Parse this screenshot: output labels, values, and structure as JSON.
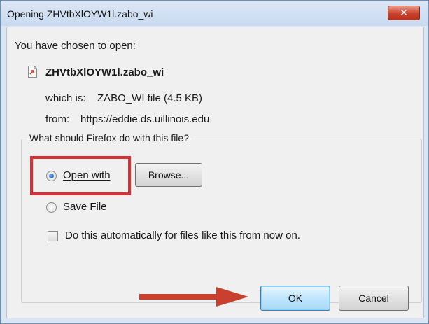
{
  "window": {
    "title": "Opening ZHVtbXlOYW1l.zabo_wi",
    "close_icon": "close-icon (X)"
  },
  "header": {
    "intro": "You have chosen to open:",
    "filename": "ZHVtbXlOYW1l.zabo_wi",
    "which_is_label": "which is:",
    "which_is_value": "ZABO_WI file (4.5 KB)",
    "from_label": "from:",
    "from_value": "https://eddie.ds.uillinois.edu"
  },
  "group": {
    "legend": "What should Firefox do with this file?",
    "open_with_label": "Open with",
    "browse_label": "Browse...",
    "save_file_label": "Save File",
    "auto_label": "Do this automatically for files like this from now on.",
    "open_with_selected": true,
    "auto_checked": false
  },
  "buttons": {
    "ok_label": "OK",
    "cancel_label": "Cancel"
  },
  "annotation_color": "#d93035"
}
